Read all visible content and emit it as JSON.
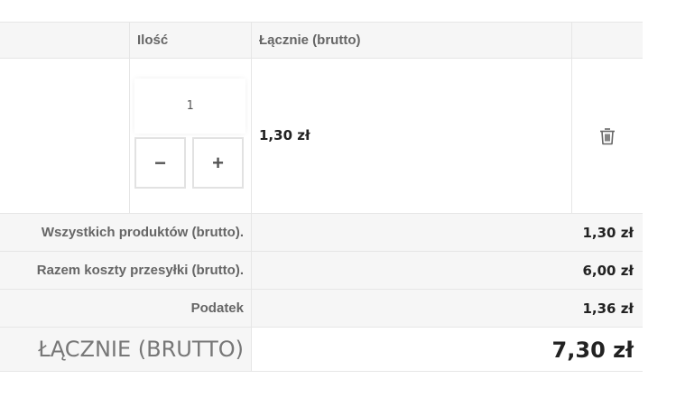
{
  "table": {
    "headers": {
      "quantity": "Ilość",
      "total": "Łącznie (brutto)"
    }
  },
  "item": {
    "quantity": "1",
    "decrement_label": "−",
    "increment_label": "+",
    "line_total": "1,30 zł"
  },
  "summary": {
    "products_label": "Wszystkich produktów (brutto).",
    "products_value": "1,30 zł",
    "shipping_label": "Razem koszty przesyłki (brutto).",
    "shipping_value": "6,00 zł",
    "tax_label": "Podatek",
    "tax_value": "1,36 zł",
    "grand_label": "ŁĄCZNIE (BRUTTO)",
    "grand_value": "7,30 zł"
  },
  "icons": {
    "remove": "trash-icon"
  },
  "colors": {
    "row_bg": "#f6f6f6",
    "border": "#e6e6e6",
    "text": "#222222",
    "muted": "#666666"
  }
}
